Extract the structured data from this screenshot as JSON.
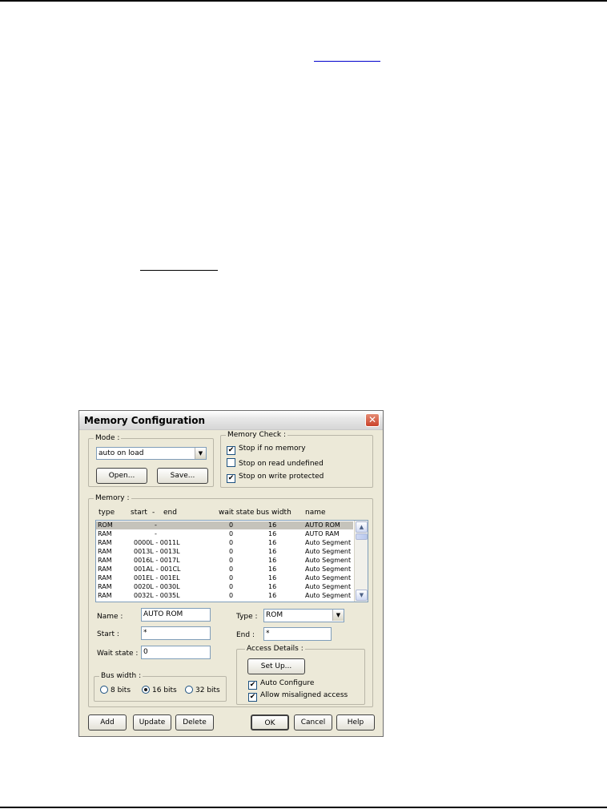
{
  "dialog": {
    "title": "Memory Configuration",
    "close_icon": "close-icon"
  },
  "mode": {
    "label": "Mode :",
    "selected": "auto on load",
    "open_label": "Open...",
    "save_label": "Save..."
  },
  "memory_check": {
    "label": "Memory Check :",
    "options": [
      {
        "label": "Stop if no memory",
        "checked": true
      },
      {
        "label": "Stop on read undefined",
        "checked": false
      },
      {
        "label": "Stop on write protected",
        "checked": true
      }
    ]
  },
  "memory": {
    "label": "Memory :",
    "columns": {
      "type": "type",
      "start": "start",
      "dash": "-",
      "end": "end",
      "wait_state": "wait state",
      "bus_width": "bus width",
      "name": "name"
    },
    "rows": [
      {
        "type": "ROM",
        "range": "-",
        "wait": "0",
        "bus": "16",
        "name": "AUTO ROM",
        "selected": true
      },
      {
        "type": "RAM",
        "range": "-",
        "wait": "0",
        "bus": "16",
        "name": "AUTO RAM",
        "selected": false
      },
      {
        "type": "RAM",
        "range": "0000L - 0011L",
        "wait": "0",
        "bus": "16",
        "name": "Auto Segment",
        "selected": false
      },
      {
        "type": "RAM",
        "range": "0013L - 0013L",
        "wait": "0",
        "bus": "16",
        "name": "Auto Segment",
        "selected": false
      },
      {
        "type": "RAM",
        "range": "0016L - 0017L",
        "wait": "0",
        "bus": "16",
        "name": "Auto Segment",
        "selected": false
      },
      {
        "type": "RAM",
        "range": "001AL - 001CL",
        "wait": "0",
        "bus": "16",
        "name": "Auto Segment",
        "selected": false
      },
      {
        "type": "RAM",
        "range": "001EL - 001EL",
        "wait": "0",
        "bus": "16",
        "name": "Auto Segment",
        "selected": false
      },
      {
        "type": "RAM",
        "range": "0020L - 0030L",
        "wait": "0",
        "bus": "16",
        "name": "Auto Segment",
        "selected": false
      },
      {
        "type": "RAM",
        "range": "0032L - 0035L",
        "wait": "0",
        "bus": "16",
        "name": "Auto Segment",
        "selected": false
      }
    ]
  },
  "fields": {
    "name_label": "Name :",
    "name_value": "AUTO ROM",
    "start_label": "Start :",
    "start_value": "*",
    "wait_label": "Wait state :",
    "wait_value": "0",
    "type_label": "Type :",
    "type_value": "ROM",
    "end_label": "End :",
    "end_value": "*"
  },
  "bus_width": {
    "label": "Bus width :",
    "options": [
      {
        "label": "8 bits",
        "selected": false
      },
      {
        "label": "16 bits",
        "selected": true
      },
      {
        "label": "32 bits",
        "selected": false
      }
    ]
  },
  "access_details": {
    "label": "Access Details :",
    "setup_label": "Set Up...",
    "auto_configure": {
      "label": "Auto Configure",
      "checked": true
    },
    "misaligned": {
      "label": "Allow misaligned access",
      "checked": true
    }
  },
  "footer": {
    "add": "Add",
    "update": "Update",
    "delete": "Delete",
    "ok": "OK",
    "cancel": "Cancel",
    "help": "Help"
  }
}
